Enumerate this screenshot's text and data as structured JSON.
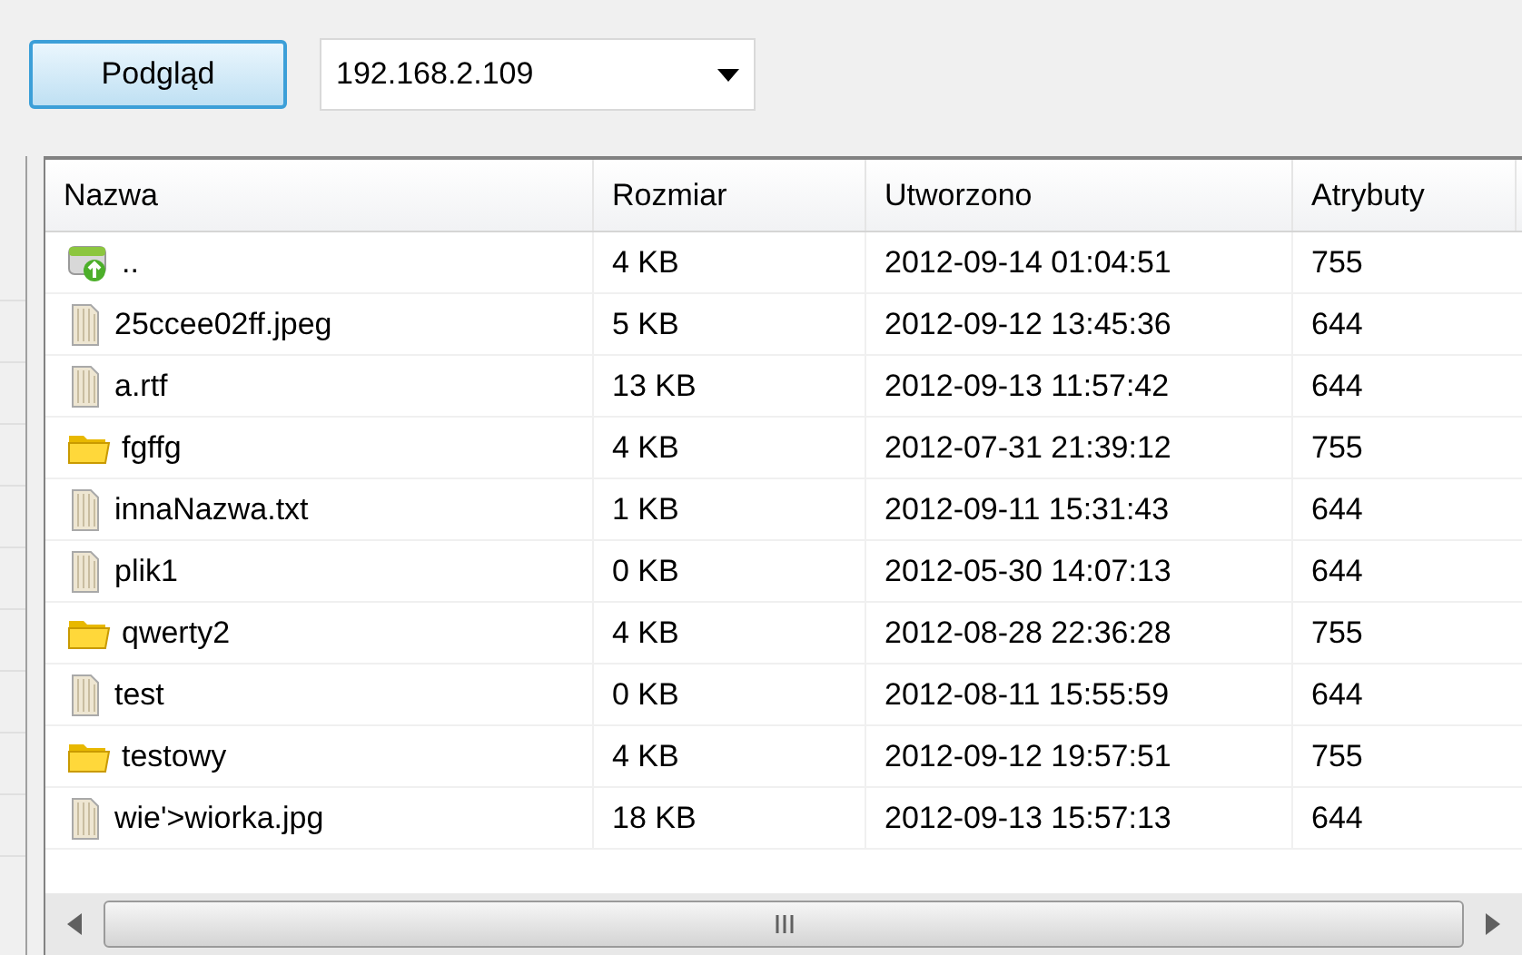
{
  "toolbar": {
    "preview_button": "Podgląd",
    "host_combo": {
      "value": "192.168.2.109"
    }
  },
  "table": {
    "columns": [
      "Nazwa",
      "Rozmiar",
      "Utworzono",
      "Atrybuty"
    ],
    "rows": [
      {
        "kind": "up",
        "name": "..",
        "size": "4 KB",
        "created": "2012-09-14 01:04:51",
        "attributes": "755"
      },
      {
        "kind": "file",
        "name": "25ccee02ff.jpeg",
        "size": "5 KB",
        "created": "2012-09-12 13:45:36",
        "attributes": "644"
      },
      {
        "kind": "file",
        "name": "a.rtf",
        "size": "13 KB",
        "created": "2012-09-13 11:57:42",
        "attributes": "644"
      },
      {
        "kind": "folder",
        "name": "fgffg",
        "size": "4 KB",
        "created": "2012-07-31 21:39:12",
        "attributes": "755"
      },
      {
        "kind": "file",
        "name": "innaNazwa.txt",
        "size": "1 KB",
        "created": "2012-09-11 15:31:43",
        "attributes": "644"
      },
      {
        "kind": "file",
        "name": "plik1",
        "size": "0 KB",
        "created": "2012-05-30 14:07:13",
        "attributes": "644"
      },
      {
        "kind": "folder",
        "name": "qwerty2",
        "size": "4 KB",
        "created": "2012-08-28 22:36:28",
        "attributes": "755"
      },
      {
        "kind": "file",
        "name": "test",
        "size": "0 KB",
        "created": "2012-08-11 15:55:59",
        "attributes": "644"
      },
      {
        "kind": "folder",
        "name": "testowy",
        "size": "4 KB",
        "created": "2012-09-12 19:57:51",
        "attributes": "755"
      },
      {
        "kind": "file",
        "name": "wie'>wiorka.jpg",
        "size": "18 KB",
        "created": "2012-09-13 15:57:13",
        "attributes": "644"
      }
    ]
  }
}
